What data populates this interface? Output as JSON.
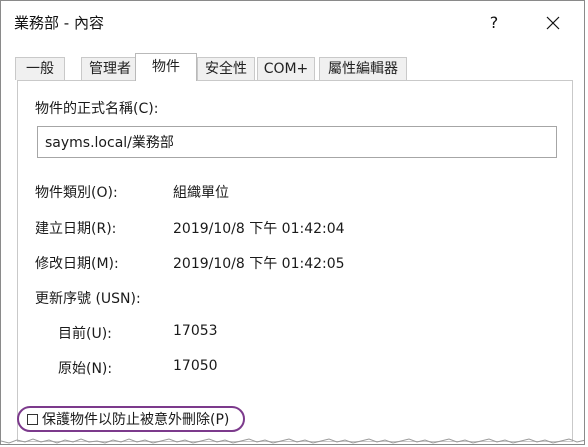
{
  "window": {
    "title": "業務部 - 內容",
    "help_label": "?"
  },
  "tabs": [
    {
      "label": "一般",
      "active": false
    },
    {
      "label": "管理者",
      "active": false
    },
    {
      "label": "物件",
      "active": true
    },
    {
      "label": "安全性",
      "active": false
    },
    {
      "label": "COM+",
      "active": false
    },
    {
      "label": "屬性編輯器",
      "active": false
    }
  ],
  "object": {
    "canonical_name_label": "物件的正式名稱(C):",
    "canonical_name_value": "sayms.local/業務部",
    "class_label": "物件類別(O):",
    "class_value": "組織單位",
    "created_label": "建立日期(R):",
    "created_value": "2019/10/8 下午 01:42:04",
    "modified_label": "修改日期(M):",
    "modified_value": "2019/10/8 下午 01:42:05",
    "usn_label": "更新序號 (USN):",
    "current_label": "目前(U):",
    "current_value": "17053",
    "original_label": "原始(N):",
    "original_value": "17050",
    "protect_label": "保護物件以防止被意外刪除(P)",
    "protect_checked": false
  },
  "colors": {
    "highlight_outline": "#7c3a8c"
  }
}
